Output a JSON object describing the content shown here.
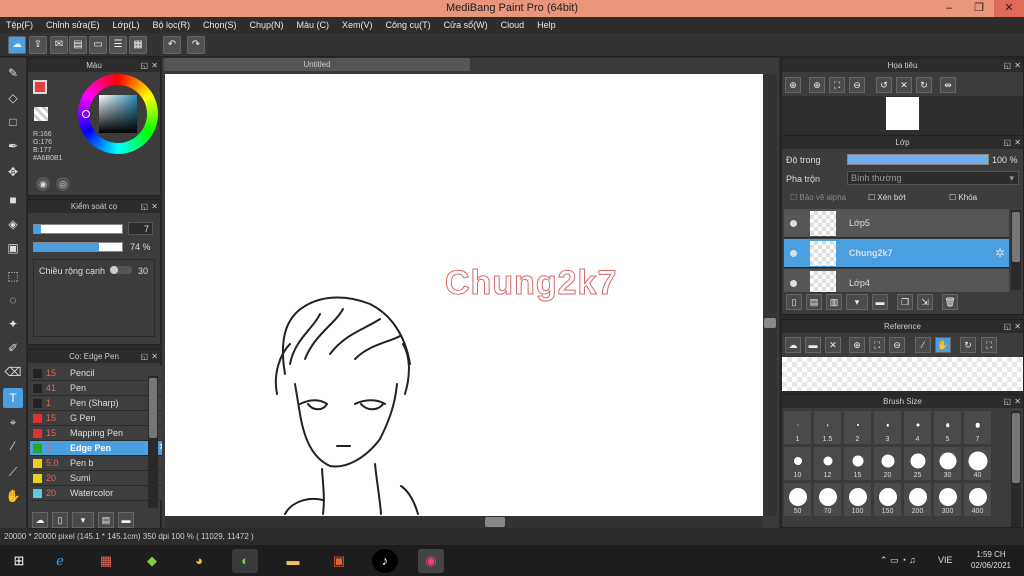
{
  "window": {
    "title": "MediBang Paint Pro (64bit)",
    "min": "–",
    "max": "❐",
    "close": "✕"
  },
  "menu": [
    "Tệp(F)",
    "Chỉnh sửa(E)",
    "Lớp(L)",
    "Bộ lọc(R)",
    "Chọn(S)",
    "Chụp(N)",
    "Màu (C)",
    "Xem(V)",
    "Công cụ(T)",
    "Cửa sổ(W)",
    "Cloud",
    "Help"
  ],
  "color_panel": {
    "title": "Màu",
    "r": "R:166",
    "g": "G:176",
    "b": "B:177",
    "hex": "#A6B0B1",
    "hue_color": "#2c8fb8"
  },
  "brush_control": {
    "title": "Kiểm soát cọ",
    "size": "7",
    "opacity": "74 %",
    "opacity_fraction": 0.74,
    "edge_label": "Chiều rộng cạnh",
    "edge_value": "30"
  },
  "brush_list": {
    "title": "Cọ: Edge Pen",
    "items": [
      {
        "size": "15",
        "name": "Pencil",
        "color": "#222222"
      },
      {
        "size": "41",
        "name": "Pen",
        "color": "#222222"
      },
      {
        "size": "1",
        "name": "Pen (Sharp)",
        "color": "#222222"
      },
      {
        "size": "15",
        "name": "G Pen",
        "color": "#e03030"
      },
      {
        "size": "15",
        "name": "Mapping Pen",
        "color": "#e03030"
      },
      {
        "size": "7",
        "name": "Edge Pen",
        "color": "#22aa22",
        "selected": true
      },
      {
        "size": "5.0",
        "name": "Pen b",
        "color": "#e8d020"
      },
      {
        "size": "20",
        "name": "Sumi",
        "color": "#e8d020"
      },
      {
        "size": "20",
        "name": "Watercolor",
        "color": "#60c8e8"
      }
    ]
  },
  "canvas": {
    "tab": "Untitled",
    "watermark": "Chung2k7"
  },
  "navigator": {
    "title": "Họa tiêu"
  },
  "layers": {
    "title": "Lớp",
    "opacity_label": "Độ trong",
    "opacity_value": "100 %",
    "blend_label": "Pha trộn",
    "blend_value": "Bình thường",
    "protect_alpha": "Bảo vệ alpha",
    "clip": "Xén bớt",
    "lock": "Khóa",
    "items": [
      {
        "name": "Lớp5",
        "selected": false
      },
      {
        "name": "Chung2k7",
        "selected": true
      },
      {
        "name": "Lớp4",
        "selected": false
      }
    ]
  },
  "reference": {
    "title": "Reference"
  },
  "brush_size": {
    "title": "Brush Size",
    "sizes": [
      "1",
      "1.5",
      "2",
      "3",
      "4",
      "5",
      "7",
      "10",
      "12",
      "15",
      "20",
      "25",
      "30",
      "40",
      "50",
      "70",
      "100",
      "150",
      "200",
      "300",
      "400"
    ]
  },
  "status": "20000 * 20000 pixel   (145.1 * 145.1cm)   350 dpi   100 %   ( 11029, 11472 )",
  "taskbar": {
    "lang": "VIE",
    "time": "1:59 CH",
    "date": "02/06/2021"
  }
}
